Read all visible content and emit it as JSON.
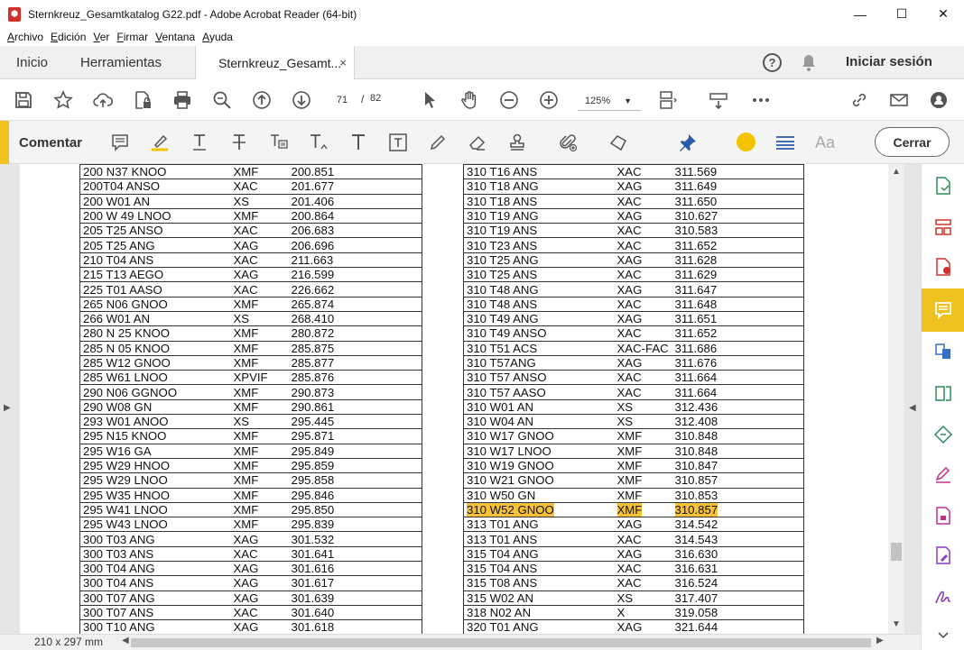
{
  "window": {
    "title": "Sternkreuz_Gesamtkatalog G22.pdf - Adobe Acrobat Reader (64-bit)",
    "minimize": "—",
    "maximize": "☐",
    "close": "✕"
  },
  "menu": [
    "Archivo",
    "Edición",
    "Ver",
    "Firmar",
    "Ventana",
    "Ayuda"
  ],
  "tabs": {
    "home": "Inicio",
    "tools": "Herramientas",
    "document": "Sternkreuz_Gesamt...",
    "close": "×",
    "help": "?",
    "signin": "Iniciar sesión"
  },
  "toolbar": {
    "page_current": "71",
    "page_separator": "/",
    "page_total": "82",
    "zoom": "125%"
  },
  "comment_toolbar": {
    "label": "Comentar",
    "close_label": "Cerrar",
    "text_style": "Aa",
    "accent_color": "#f0c21f",
    "highlight_color": "#f5c400"
  },
  "status": {
    "page_size": "210 x 297 mm"
  },
  "catalog": {
    "left": [
      [
        "200 N37 KNOO",
        "XMF",
        "200.851"
      ],
      [
        "200T04 ANSO",
        "XAC",
        "201.677"
      ],
      [
        "200 W01 AN",
        "XS",
        "201.406"
      ],
      [
        "200 W 49 LNOO",
        "XMF",
        "200.864"
      ],
      [
        "205 T25 ANSO",
        "XAC",
        "206.683"
      ],
      [
        "205 T25 ANG",
        "XAG",
        "206.696"
      ],
      [
        "210 T04 ANS",
        "XAC",
        "211.663"
      ],
      [
        "215 T13 AEGO",
        "XAG",
        "216.599"
      ],
      [
        "225 T01 AASO",
        "XAC",
        "226.662"
      ],
      [
        "265 N06 GNOO",
        "XMF",
        "265.874"
      ],
      [
        "266 W01 AN",
        "XS",
        "268.410"
      ],
      [
        "280 N 25 KNOO",
        "XMF",
        "280.872"
      ],
      [
        "285 N 05 KNOO",
        "XMF",
        "285.875"
      ],
      [
        "285 W12 GNOO",
        "XMF",
        "285.877"
      ],
      [
        "285 W61 LNOO",
        "XPVIF",
        "285.876"
      ],
      [
        "290 N06 GGNOO",
        "XMF",
        "290.873"
      ],
      [
        "290 W08 GN",
        "XMF",
        "290.861"
      ],
      [
        "293 W01 ANOO",
        "XS",
        "295.445"
      ],
      [
        "295 N15 KNOO",
        "XMF",
        "295.871"
      ],
      [
        "295 W16 GA",
        "XMF",
        "295.849"
      ],
      [
        "295 W29 HNOO",
        "XMF",
        "295.859"
      ],
      [
        "295 W29 LNOO",
        "XMF",
        "295.858"
      ],
      [
        "295 W35 HNOO",
        "XMF",
        "295.846"
      ],
      [
        "295 W41 LNOO",
        "XMF",
        "295.850"
      ],
      [
        "295 W43 LNOO",
        "XMF",
        "295.839"
      ],
      [
        "300 T03 ANG",
        "XAG",
        "301.532"
      ],
      [
        "300 T03 ANS",
        "XAC",
        "301.641"
      ],
      [
        "300 T04 ANG",
        "XAG",
        "301.616"
      ],
      [
        "300 T04 ANS",
        "XAG",
        "301.617"
      ],
      [
        "300 T07 ANG",
        "XAG",
        "301.639"
      ],
      [
        "300 T07 ANS",
        "XAC",
        "301.640"
      ],
      [
        "300 T10 ANG",
        "XAG",
        "301.618"
      ]
    ],
    "right": [
      [
        "310 T16 ANS",
        "XAC",
        "311.569"
      ],
      [
        "310 T18 ANG",
        "XAG",
        "311.649"
      ],
      [
        "310 T18 ANS",
        "XAC",
        "311.650"
      ],
      [
        "310 T19 ANG",
        "XAG",
        "310.627"
      ],
      [
        "310 T19 ANS",
        "XAC",
        "310.583"
      ],
      [
        "310 T23 ANS",
        "XAC",
        "311.652"
      ],
      [
        "310 T25 ANG",
        "XAG",
        "311.628"
      ],
      [
        "310 T25 ANS",
        "XAC",
        "311.629"
      ],
      [
        "310 T48 ANG",
        "XAG",
        "311.647"
      ],
      [
        "310 T48 ANS",
        "XAC",
        "311.648"
      ],
      [
        "310 T49 ANG",
        "XAG",
        "311.651"
      ],
      [
        "310 T49 ANSO",
        "XAC",
        "311.652"
      ],
      [
        "310 T51 ACS",
        "XAC-FAC",
        "311.686"
      ],
      [
        "310 T57ANG",
        "XAG",
        "311.676"
      ],
      [
        "310 T57 ANSO",
        "XAC",
        "311.664"
      ],
      [
        "310 T57 AASO",
        "XAC",
        "311.664"
      ],
      [
        "310 W01 AN",
        "XS",
        "312.436"
      ],
      [
        "310 W04 AN",
        "XS",
        "312.408"
      ],
      [
        "310 W17 GNOO",
        "XMF",
        "310.848"
      ],
      [
        "310 W17 LNOO",
        "XMF",
        "310.848"
      ],
      [
        "310 W19 GNOO",
        "XMF",
        "310.847"
      ],
      [
        "310 W21 GNOO",
        "XMF",
        "310.857"
      ],
      [
        "310 W50 GN",
        "XMF",
        "310.853"
      ],
      [
        "310 W52 GNOO",
        "XMF",
        "310.857"
      ],
      [
        "313 T01 ANG",
        "XAG",
        "314.542"
      ],
      [
        "313 T01 ANS",
        "XAC",
        "314.543"
      ],
      [
        "315 T04 ANG",
        "XAG",
        "316.630"
      ],
      [
        "315 T04 ANS",
        "XAC",
        "316.631"
      ],
      [
        "315 T08 ANS",
        "XAC",
        "316.524"
      ],
      [
        "315 W02 AN",
        "XS",
        "317.407"
      ],
      [
        "318 N02 AN",
        "X",
        "319.058"
      ],
      [
        "320 T01 ANG",
        "XAG",
        "321.644"
      ]
    ],
    "highlighted_right_row": 23
  }
}
